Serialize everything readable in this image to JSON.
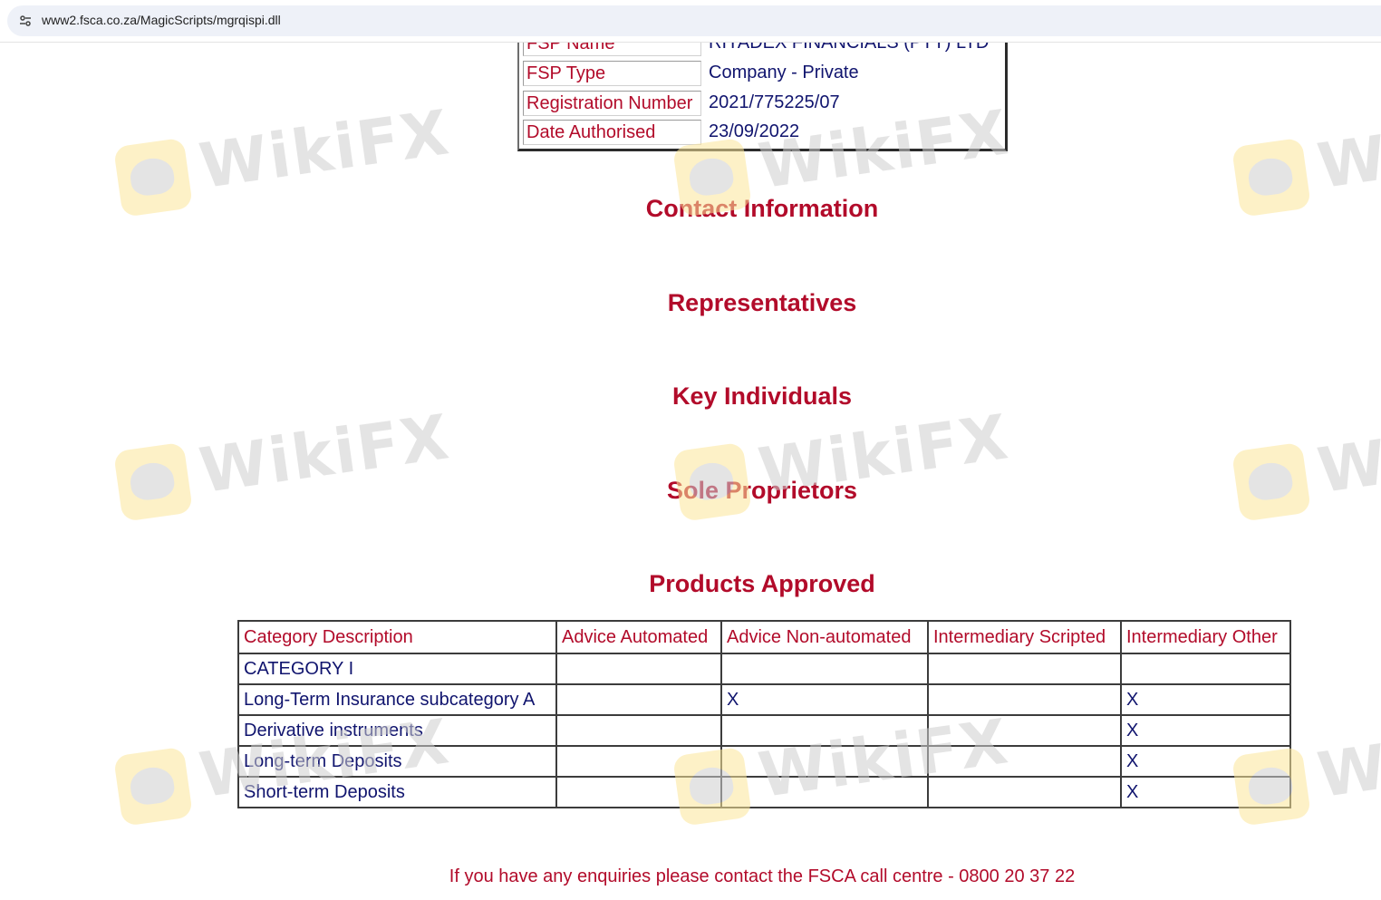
{
  "browser": {
    "url": "www2.fsca.co.za/MagicScripts/mgrqispi.dll",
    "site_info_icon": "tune-icon"
  },
  "fsp_details": [
    {
      "label": "FSP Name",
      "value": "RIYADEX FINANCIALS (PTY) LTD"
    },
    {
      "label": "FSP Type",
      "value": "Company - Private"
    },
    {
      "label": "Registration Number",
      "value": "2021/775225/07"
    },
    {
      "label": "Date Authorised",
      "value": "23/09/2022"
    }
  ],
  "sections": {
    "contact": "Contact Information",
    "representatives": "Representatives",
    "key_individuals": "Key Individuals",
    "sole_proprietors": "Sole Proprietors",
    "products": "Products Approved"
  },
  "products_table": {
    "headers": [
      "Category Description",
      "Advice Automated",
      "Advice Non-automated",
      "Intermediary Scripted",
      "Intermediary Other"
    ],
    "rows": [
      [
        "CATEGORY I",
        "",
        "",
        "",
        ""
      ],
      [
        "Long-Term Insurance subcategory A",
        "",
        "X",
        "",
        "X"
      ],
      [
        "Derivative instruments",
        "",
        "",
        "",
        "X"
      ],
      [
        "Long-term Deposits",
        "",
        "",
        "",
        "X"
      ],
      [
        "Short-term Deposits",
        "",
        "",
        "",
        "X"
      ]
    ]
  },
  "footer_note": "If you have any enquiries please contact the FSCA call centre - 0800 20 37 22",
  "watermark": {
    "text": "WikiFX",
    "icon": "wikifx-logo-icon"
  },
  "colors": {
    "heading": "#b20b2a",
    "value_text": "#10146e"
  }
}
